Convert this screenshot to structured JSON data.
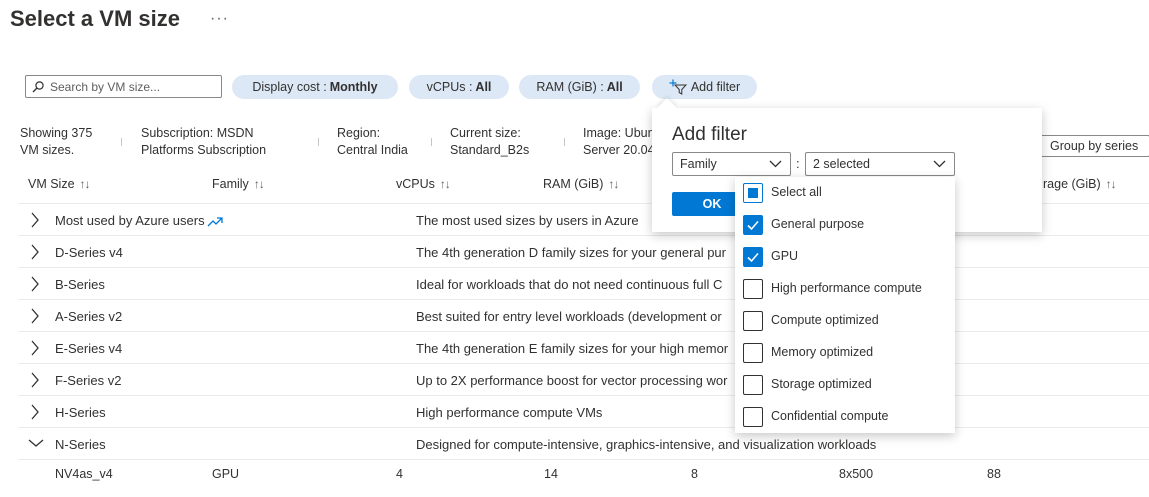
{
  "page": {
    "title": "Select a VM size",
    "more": "···"
  },
  "search": {
    "placeholder": "Search by VM size..."
  },
  "pills": {
    "display_cost_label": "Display cost :",
    "display_cost_value": "Monthly",
    "vcpus_label": "vCPUs :",
    "vcpus_value": "All",
    "ram_label": "RAM (GiB) :",
    "ram_value": "All",
    "add_filter": "Add filter"
  },
  "info": {
    "showing_1": "Showing 375",
    "showing_2": "VM sizes.",
    "subscription_1": "Subscription: MSDN",
    "subscription_2": "Platforms Subscription",
    "region_1": "Region:",
    "region_2": "Central India",
    "current_1": "Current size:",
    "current_2": "Standard_B2s",
    "image_1": "Image: Ubun",
    "image_2": "Server 20.04"
  },
  "group_by": "Group by series",
  "columns": {
    "vm_size": "VM Size",
    "family": "Family",
    "vcpus": "vCPUs",
    "ram": "RAM (GiB)",
    "storage": "rage (GiB)",
    "sort_glyph": "↑↓"
  },
  "rows": [
    {
      "name": "Most used by Azure users",
      "desc": "The most used sizes by users in Azure",
      "expanded": false
    },
    {
      "name": "D-Series v4",
      "desc": "The 4th generation D family sizes for your general pur",
      "expanded": false
    },
    {
      "name": "B-Series",
      "desc": "Ideal for workloads that do not need continuous full C",
      "expanded": false
    },
    {
      "name": "A-Series v2",
      "desc": "Best suited for entry level workloads (development or",
      "expanded": false
    },
    {
      "name": "E-Series v4",
      "desc": "The 4th generation E family sizes for your high memor",
      "expanded": false
    },
    {
      "name": "F-Series v2",
      "desc": "Up to 2X performance boost for vector processing wor",
      "expanded": false
    },
    {
      "name": "H-Series",
      "desc": "High performance compute VMs",
      "expanded": false
    },
    {
      "name": "N-Series",
      "desc": "Designed for compute-intensive, graphics-intensive, and visualization workloads",
      "expanded": true
    }
  ],
  "detail_row": {
    "name": "NV4as_v4",
    "family": "GPU",
    "vcpus": "4",
    "ram": "14",
    "col5": "8",
    "col6": "8x500",
    "col7": "88"
  },
  "filter": {
    "title": "Add filter",
    "field": "Family",
    "colon": ":",
    "value": "2 selected",
    "ok": "OK",
    "options": [
      {
        "label": "Select all",
        "state": "partial"
      },
      {
        "label": "General purpose",
        "state": "checked"
      },
      {
        "label": "GPU",
        "state": "checked"
      },
      {
        "label": "High performance compute",
        "state": "unchecked"
      },
      {
        "label": "Compute optimized",
        "state": "unchecked"
      },
      {
        "label": "Memory optimized",
        "state": "unchecked"
      },
      {
        "label": "Storage optimized",
        "state": "unchecked"
      },
      {
        "label": "Confidential compute",
        "state": "unchecked"
      }
    ]
  },
  "colors": {
    "accent": "#0078d4",
    "pill_bg": "#dde8f6",
    "text": "#323130"
  }
}
